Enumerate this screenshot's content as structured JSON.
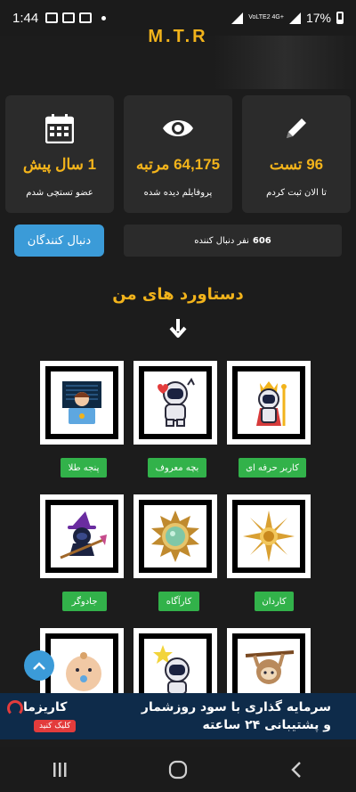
{
  "status_bar": {
    "time": "1:44",
    "network": "VoLTE2 4G+",
    "battery": "17%"
  },
  "header": {
    "brand": "M.T.R"
  },
  "stats": [
    {
      "icon": "calendar-icon",
      "value": "1 سال پیش",
      "label": "عضو تستچی شدم"
    },
    {
      "icon": "eye-icon",
      "value": "64,175 مرتبه",
      "label": "پروفایلم دیده شده"
    },
    {
      "icon": "pencil-icon",
      "value": "96 تست",
      "label": "تا الان ثبت کردم"
    }
  ],
  "followers": {
    "button_label": "دنبال کنندگان",
    "count": "606",
    "text": "نفر دنبال کننده"
  },
  "achievements": {
    "title": "دستاورد های من",
    "items": [
      {
        "label": "پنجه طلا",
        "icon": "astronaut-laptop-icon"
      },
      {
        "label": "بچه معروف",
        "icon": "astronaut-heart-icon"
      },
      {
        "label": "کاربر حرفه ای",
        "icon": "astronaut-king-icon"
      },
      {
        "label": "جادوگر",
        "icon": "astronaut-witch-icon"
      },
      {
        "label": "کارآگاه",
        "icon": "silver-medal-icon"
      },
      {
        "label": "کاردان",
        "icon": "gold-medal-icon"
      },
      {
        "label": "",
        "icon": "baby-icon"
      },
      {
        "label": "",
        "icon": "astronaut-star-icon"
      },
      {
        "label": "",
        "icon": "sloth-icon"
      }
    ]
  },
  "ad": {
    "brand": "کاریزما",
    "cta": "کلیک کنید",
    "line1": "سرمایه گذاری با سود روزشمار",
    "line2": "و پشتیبانی ۲۴ ساعته",
    "badge": "1"
  },
  "colors": {
    "accent": "#f2b31b",
    "button_blue": "#3b9bd8",
    "tag_green": "#32b24a",
    "card_bg": "#2b2b2b"
  }
}
